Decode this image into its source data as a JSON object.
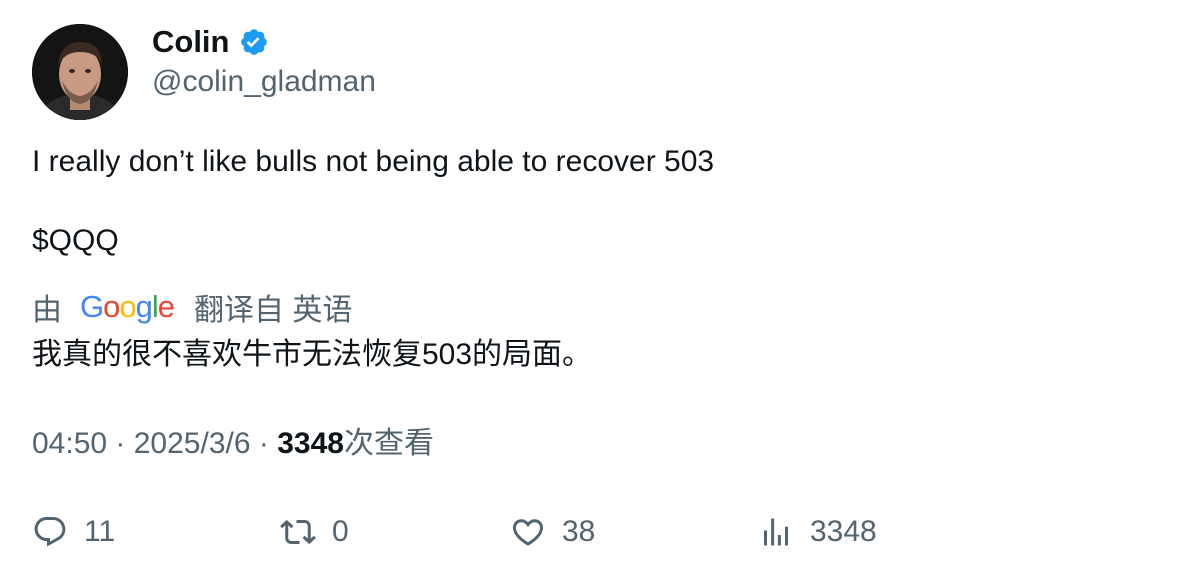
{
  "author": {
    "name": "Colin",
    "handle": "@colin_gladman",
    "verified": true,
    "badge_color": "#1D9BF0"
  },
  "tweet": {
    "line1": "I really don’t like bulls not being able to recover 503",
    "line2": "$QQQ"
  },
  "translation": {
    "by_label": "由",
    "provider": "Google",
    "from_label": "翻译自 英语",
    "text": "我真的很不喜欢牛市无法恢复503的局面。"
  },
  "meta": {
    "time": "04:50",
    "separator": " · ",
    "date": "2025/3/6",
    "views_count": "3348",
    "views_suffix": "次查看"
  },
  "actions": {
    "replies": "11",
    "retweets": "0",
    "likes": "38",
    "views": "3348"
  },
  "icons": {
    "reply": "reply-icon",
    "retweet": "retweet-icon",
    "like": "heart-icon",
    "views": "views-icon",
    "verified": "verified-badge-icon"
  },
  "colors": {
    "text": "#0f1419",
    "secondary": "#536471",
    "accent": "#1D9BF0"
  }
}
